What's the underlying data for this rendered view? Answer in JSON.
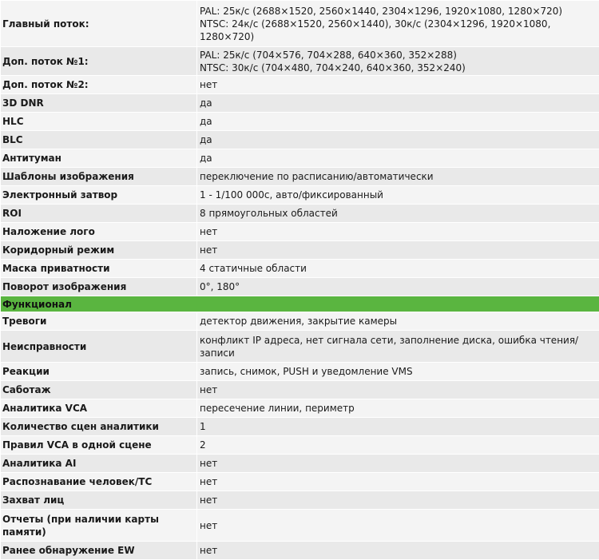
{
  "rows_top": [
    {
      "key": "Главный поток:",
      "value_lines": [
        "PAL: 25к/с (2688×1520, 2560×1440, 2304×1296, 1920×1080, 1280×720)",
        "NTSC: 24к/с (2688×1520, 2560×1440), 30к/с (2304×1296, 1920×1080,",
        "1280×720)"
      ]
    },
    {
      "key": "Доп. поток №1:",
      "value_lines": [
        "PAL: 25к/с (704×576, 704×288, 640×360, 352×288)",
        "NTSC: 30к/с (704×480, 704×240, 640×360, 352×240)"
      ]
    },
    {
      "key": "Доп. поток №2:",
      "value_lines": [
        "нет"
      ]
    },
    {
      "key": "3D DNR",
      "value_lines": [
        "да"
      ]
    },
    {
      "key": "HLC",
      "value_lines": [
        "да"
      ]
    },
    {
      "key": "BLC",
      "value_lines": [
        "да"
      ]
    },
    {
      "key": "Антитуман",
      "value_lines": [
        "да"
      ]
    },
    {
      "key": "Шаблоны изображения",
      "value_lines": [
        "переключение по расписанию/автоматически"
      ]
    },
    {
      "key": "Электронный затвор",
      "value_lines": [
        "1 - 1/100 000с, авто/фиксированный"
      ]
    },
    {
      "key": "ROI",
      "value_lines": [
        "8 прямоугольных областей"
      ]
    },
    {
      "key": "Наложение лого",
      "value_lines": [
        "нет"
      ]
    },
    {
      "key": "Коридорный режим",
      "value_lines": [
        "нет"
      ]
    },
    {
      "key": "Маска приватности",
      "value_lines": [
        "4 статичные области"
      ]
    },
    {
      "key": "Поворот изображения",
      "value_lines": [
        "0°, 180°"
      ]
    }
  ],
  "section_title": "Функционал",
  "rows_bottom": [
    {
      "key": "Тревоги",
      "value_lines": [
        "детектор движения, закрытие камеры"
      ]
    },
    {
      "key": "Неисправности",
      "value_lines": [
        "конфликт IP адреса, нет сигнала сети, заполнение диска, ошибка чтения/",
        "записи"
      ]
    },
    {
      "key": "Реакции",
      "value_lines": [
        "запись, снимок, PUSH и уведомление VMS"
      ]
    },
    {
      "key": "Саботаж",
      "value_lines": [
        "нет"
      ]
    },
    {
      "key": "Аналитика VCA",
      "value_lines": [
        "пересечение линии, периметр"
      ]
    },
    {
      "key": "Количество сцен аналитики",
      "value_lines": [
        "1"
      ]
    },
    {
      "key": "Правил VCA в одной сцене",
      "value_lines": [
        "2"
      ]
    },
    {
      "key": "Аналитика AI",
      "value_lines": [
        "нет"
      ]
    },
    {
      "key": "Распознавание человек/ТС",
      "value_lines": [
        "нет"
      ]
    },
    {
      "key": "Захват лиц",
      "value_lines": [
        "нет"
      ]
    },
    {
      "key": "Отчеты (при наличии карты памяти)",
      "value_lines": [
        "нет"
      ]
    },
    {
      "key": "Ранее обнаружение EW",
      "value_lines": [
        "нет"
      ]
    }
  ],
  "colors": {
    "section_bg": "#5ab540",
    "row_bg": "#f4f4f4",
    "row_alt_bg": "#e9e9e9"
  }
}
